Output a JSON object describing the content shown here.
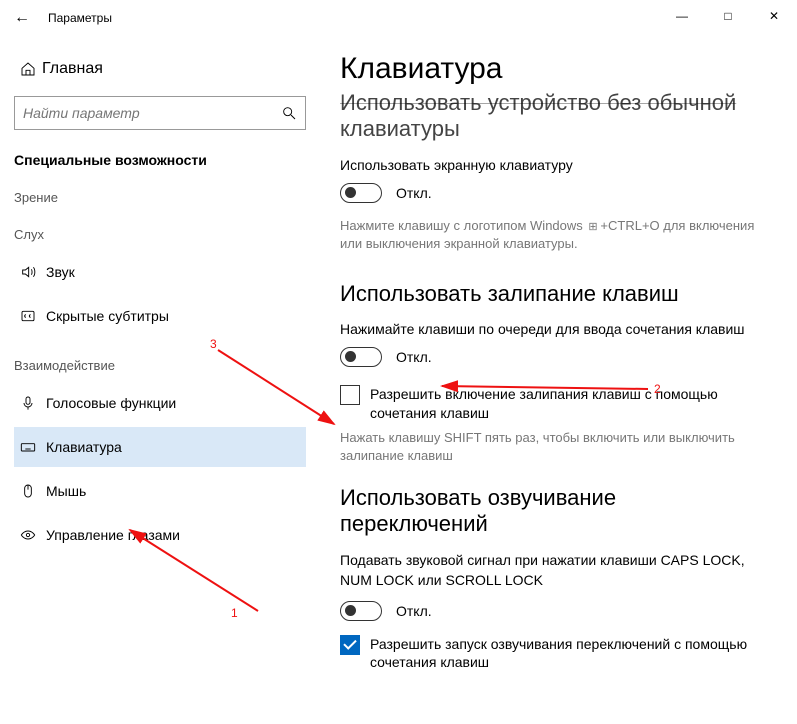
{
  "titlebar": {
    "title": "Параметры"
  },
  "sidebar": {
    "home": "Главная",
    "search_placeholder": "Найти параметр",
    "section_title": "Специальные возможности",
    "groups": [
      {
        "label": "Зрение",
        "items": []
      },
      {
        "label": "Слух",
        "items": [
          {
            "icon": "sound-icon",
            "label": "Звук"
          },
          {
            "icon": "cc-icon",
            "label": "Скрытые субтитры"
          }
        ]
      },
      {
        "label": "Взаимодействие",
        "items": [
          {
            "icon": "mic-icon",
            "label": "Голосовые функции"
          },
          {
            "icon": "keyboard-icon",
            "label": "Клавиатура",
            "selected": true
          },
          {
            "icon": "mouse-icon",
            "label": "Мышь"
          },
          {
            "icon": "eye-icon",
            "label": "Управление глазами"
          }
        ]
      }
    ]
  },
  "content": {
    "page_title": "Клавиатура",
    "truncated_heading": "Использовать устройство без обычной клавиатуры",
    "osk_desc": "Использовать экранную клавиатуру",
    "off_label": "Откл.",
    "osk_hint_a": "Нажмите клавишу с логотипом Windows",
    "osk_hint_b": "+CTRL+O для включения или выключения экранной клавиатуры.",
    "sticky_heading": "Использовать залипание клавиш",
    "sticky_desc": "Нажимайте клавиши по очереди для ввода сочетания клавиш",
    "sticky_checkbox": "Разрешить включение залипания клавиш с помощью сочетания клавиш",
    "sticky_hint": "Нажать клавишу SHIFT пять раз, чтобы включить или выключить залипание клавиш",
    "toggle_keys_heading": "Использовать озвучивание переключений",
    "toggle_keys_desc": "Подавать звуковой сигнал при нажатии клавиши CAPS LOCK, NUM LOCK или SCROLL LOCK",
    "toggle_keys_checkbox": "Разрешить запуск озвучивания переключений с помощью сочетания клавиш"
  },
  "annotations": {
    "n1": "1",
    "n2": "2",
    "n3": "3"
  }
}
